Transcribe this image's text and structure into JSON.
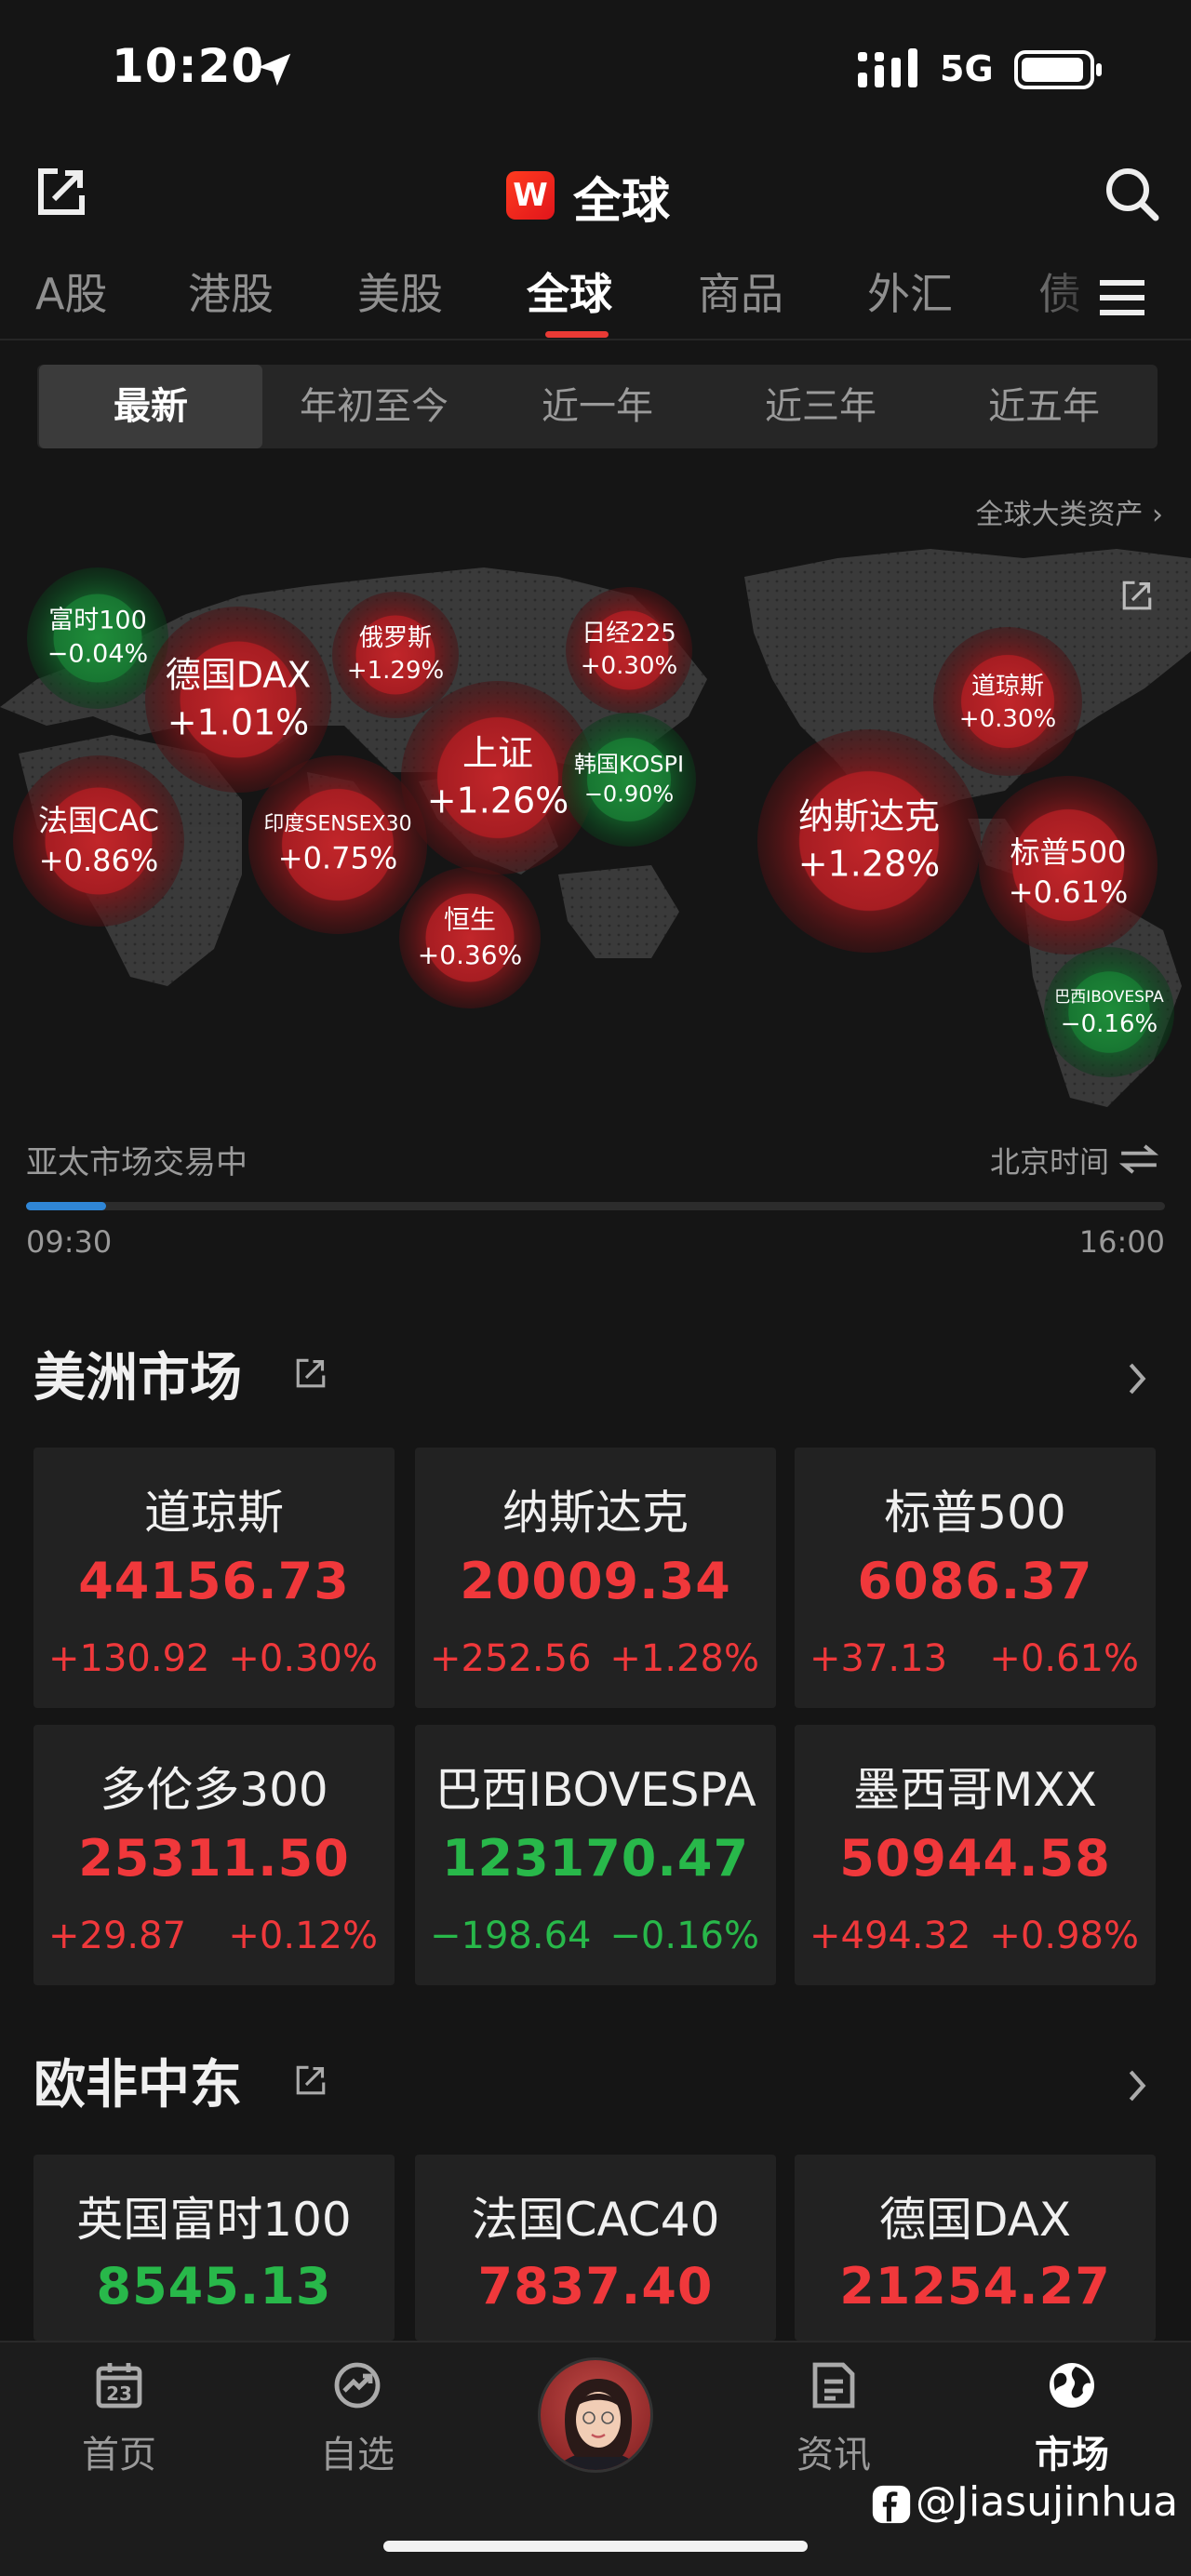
{
  "status_bar": {
    "time": "10:20",
    "network": "5G"
  },
  "header": {
    "logo_letter": "W",
    "title": "全球"
  },
  "tabs": [
    {
      "label": "A股"
    },
    {
      "label": "港股"
    },
    {
      "label": "美股"
    },
    {
      "label": "全球",
      "active": true
    },
    {
      "label": "商品"
    },
    {
      "label": "外汇"
    },
    {
      "label": "债"
    }
  ],
  "periods": [
    {
      "label": "最新",
      "active": true
    },
    {
      "label": "年初至今"
    },
    {
      "label": "近一年"
    },
    {
      "label": "近三年"
    },
    {
      "label": "近五年"
    }
  ],
  "asset_link": "全球大类资产 ›",
  "map": {
    "bubbles": [
      {
        "name": "富时100",
        "change": "−0.04%",
        "dir": "down"
      },
      {
        "name": "德国DAX",
        "change": "+1.01%",
        "dir": "up"
      },
      {
        "name": "俄罗斯",
        "change": "+1.29%",
        "dir": "up"
      },
      {
        "name": "日经225",
        "change": "+0.30%",
        "dir": "up"
      },
      {
        "name": "法国CAC",
        "change": "+0.86%",
        "dir": "up"
      },
      {
        "name": "印度SENSEX30",
        "change": "+0.75%",
        "dir": "up"
      },
      {
        "name": "上证",
        "change": "+1.26%",
        "dir": "up"
      },
      {
        "name": "韩国KOSPI",
        "change": "−0.90%",
        "dir": "down"
      },
      {
        "name": "恒生",
        "change": "+0.36%",
        "dir": "up"
      },
      {
        "name": "纳斯达克",
        "change": "+1.28%",
        "dir": "up"
      },
      {
        "name": "道琼斯",
        "change": "+0.30%",
        "dir": "up"
      },
      {
        "name": "标普500",
        "change": "+0.61%",
        "dir": "up"
      },
      {
        "name": "巴西IBOVESPA",
        "change": "−0.16%",
        "dir": "down"
      }
    ]
  },
  "session": {
    "status": "亚太市场交易中",
    "timezone": "北京时间",
    "start": "09:30",
    "end": "16:00",
    "progress": 0.07
  },
  "americas": {
    "title": "美洲市场",
    "cards": [
      {
        "name": "道琼斯",
        "value": "44156.73",
        "change": "+130.92",
        "pct": "+0.30%",
        "dir": "up"
      },
      {
        "name": "纳斯达克",
        "value": "20009.34",
        "change": "+252.56",
        "pct": "+1.28%",
        "dir": "up"
      },
      {
        "name": "标普500",
        "value": "6086.37",
        "change": "+37.13",
        "pct": "+0.61%",
        "dir": "up"
      },
      {
        "name": "多伦多300",
        "value": "25311.50",
        "change": "+29.87",
        "pct": "+0.12%",
        "dir": "up"
      },
      {
        "name": "巴西IBOVESPA",
        "value": "123170.47",
        "change": "−198.64",
        "pct": "−0.16%",
        "dir": "down"
      },
      {
        "name": "墨西哥MXX",
        "value": "50944.58",
        "change": "+494.32",
        "pct": "+0.98%",
        "dir": "up"
      }
    ]
  },
  "emea": {
    "title": "欧非中东",
    "cards": [
      {
        "name": "英国富时100",
        "value": "8545.13",
        "dir": "down"
      },
      {
        "name": "法国CAC40",
        "value": "7837.40",
        "dir": "up"
      },
      {
        "name": "德国DAX",
        "value": "21254.27",
        "dir": "up"
      }
    ]
  },
  "bottom_nav": [
    {
      "label": "首页",
      "icon": "calendar-icon",
      "badge": "23"
    },
    {
      "label": "自选",
      "icon": "trend-icon"
    },
    {
      "label": "资讯",
      "icon": "news-icon"
    },
    {
      "label": "市场",
      "icon": "globe-icon",
      "active": true
    }
  ],
  "watermark": "@Jiasujinhua",
  "colors": {
    "up": "#f0383b",
    "down": "#28b84a",
    "accent": "#e83a35",
    "progress": "#2f86d6"
  }
}
